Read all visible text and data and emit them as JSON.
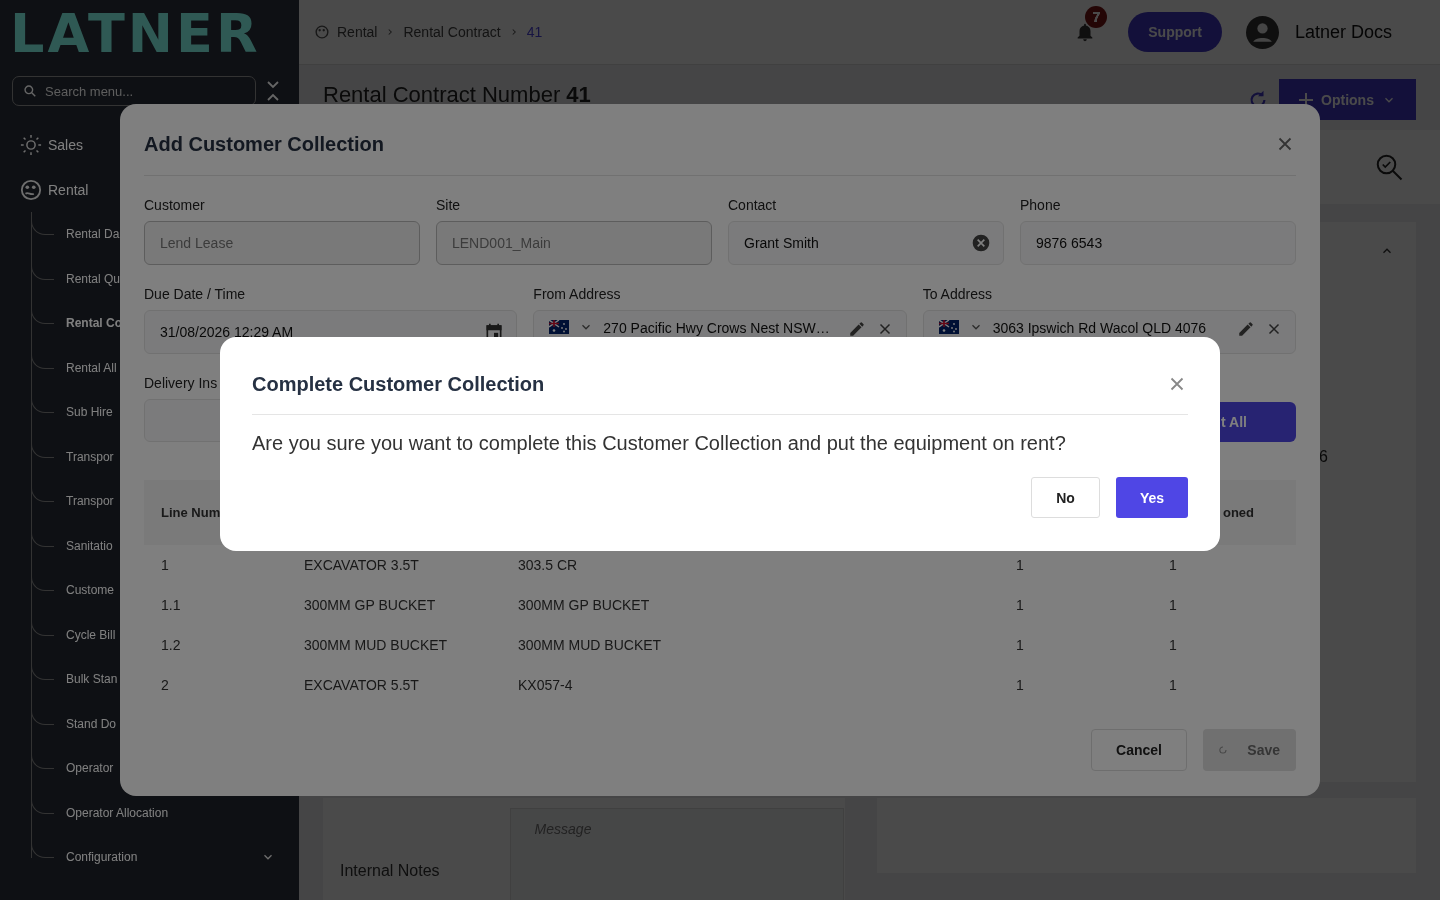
{
  "sidebar": {
    "logo": "LATNER",
    "search": {
      "placeholder": "Search menu..."
    },
    "items": [
      {
        "label": "Sales"
      },
      {
        "label": "Rental",
        "children": [
          {
            "label": "Rental Da",
            "selected": false
          },
          {
            "label": "Rental Qu",
            "selected": false
          },
          {
            "label": "Rental Co",
            "selected": true
          },
          {
            "label": "Rental All",
            "selected": false
          },
          {
            "label": "Sub Hire",
            "selected": false
          },
          {
            "label": "Transpor",
            "selected": false
          },
          {
            "label": "Transpor",
            "selected": false
          },
          {
            "label": "Sanitatio",
            "selected": false
          },
          {
            "label": "Custome",
            "selected": false
          },
          {
            "label": "Cycle Bill",
            "selected": false
          },
          {
            "label": "Bulk Stan",
            "selected": false
          },
          {
            "label": "Stand Do",
            "selected": false
          },
          {
            "label": "Operator",
            "selected": false
          },
          {
            "label": "Operator Allocation",
            "selected": false
          },
          {
            "label": "Configuration",
            "selected": false,
            "expandable": true
          }
        ]
      }
    ]
  },
  "header": {
    "breadcrumb": [
      "Rental",
      "Rental Contract",
      "41"
    ],
    "notifications": "7",
    "support": "Support",
    "user": "Latner Docs"
  },
  "page": {
    "title": "Rental Contract Number",
    "number": "41",
    "options": "Options",
    "background_value": "6",
    "message_placeholder": "Message",
    "notes_label": "Internal Notes"
  },
  "modal": {
    "title": "Add Customer Collection",
    "fields": [
      {
        "label": "Customer",
        "value": "Lend Lease",
        "disabled": true,
        "kind": "text"
      },
      {
        "label": "Site",
        "value": "LEND001_Main",
        "disabled": true,
        "kind": "text"
      },
      {
        "label": "Contact",
        "value": "Grant Smith",
        "disabled": false,
        "kind": "clearable"
      },
      {
        "label": "Phone",
        "value": "9876 6543",
        "disabled": false,
        "kind": "text"
      }
    ],
    "fields_2": [
      {
        "label": "Due Date / Time",
        "value": "31/08/2026 12:29 AM",
        "kind": "date"
      },
      {
        "label": "From Address",
        "value": "270 Pacific Hwy Crows Nest NSW…",
        "kind": "address"
      },
      {
        "label": "To Address",
        "value": "3063 Ipswich Rd Wacol QLD 4076",
        "kind": "address"
      }
    ],
    "delivery_label": "Delivery Ins",
    "action_button": "t All",
    "table": {
      "columns": [
        "Line Num",
        "oned"
      ],
      "rows": [
        [
          "1",
          "EXCAVATOR 3.5T",
          "303.5 CR",
          "1",
          "1"
        ],
        [
          "1.1",
          "300MM GP BUCKET",
          "300MM GP BUCKET",
          "1",
          "1"
        ],
        [
          "1.2",
          "300MM MUD BUCKET",
          "300MM MUD BUCKET",
          "1",
          "1"
        ],
        [
          "2",
          "EXCAVATOR 5.5T",
          "KX057-4",
          "1",
          "1"
        ]
      ]
    },
    "cancel": "Cancel",
    "save": {
      "label": "Save",
      "loading": true
    }
  },
  "confirm": {
    "title": "Complete Customer Collection",
    "message": "Are you sure you want to complete this Customer Collection and put the equipment on rent?",
    "buttons": [
      {
        "label": "No",
        "kind": "secondary"
      },
      {
        "label": "Yes",
        "kind": "primary"
      }
    ]
  }
}
